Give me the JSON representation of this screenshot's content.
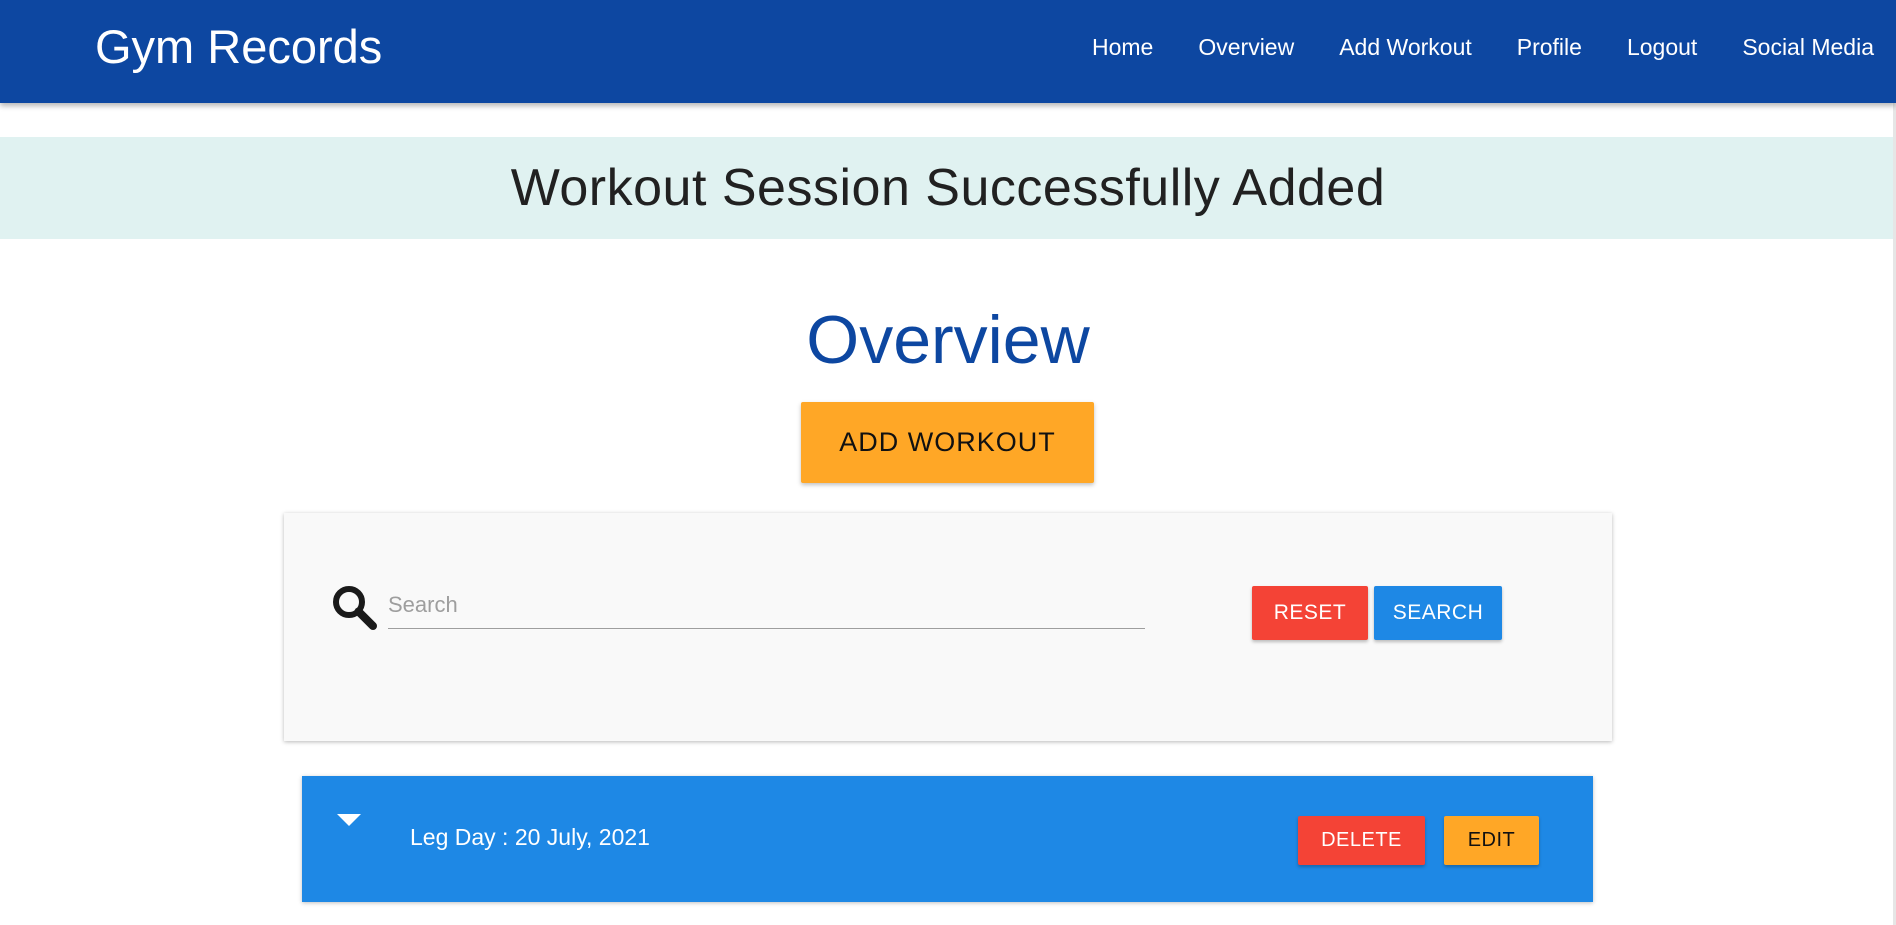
{
  "navbar": {
    "brand": "Gym Records",
    "links": [
      "Home",
      "Overview",
      "Add Workout",
      "Profile",
      "Logout",
      "Social Media"
    ],
    "background_color": "#0d47a1"
  },
  "flash": {
    "message": "Workout Session Successfully Added",
    "background_color": "#e0f2f1"
  },
  "main": {
    "title": "Overview",
    "add_workout_label": "ADD WORKOUT"
  },
  "search": {
    "icon": "search-icon",
    "placeholder": "Search",
    "value": "",
    "reset_label": "RESET",
    "search_label": "SEARCH"
  },
  "workouts": [
    {
      "title": "Leg Day : 20 July, 2021",
      "expand_icon": "caret-down-icon",
      "delete_label": "DELETE",
      "edit_label": "EDIT"
    }
  ],
  "colors": {
    "primary": "#0d47a1",
    "accent_orange": "#ffa726",
    "danger_red": "#f44336",
    "info_blue": "#1e88e5"
  }
}
